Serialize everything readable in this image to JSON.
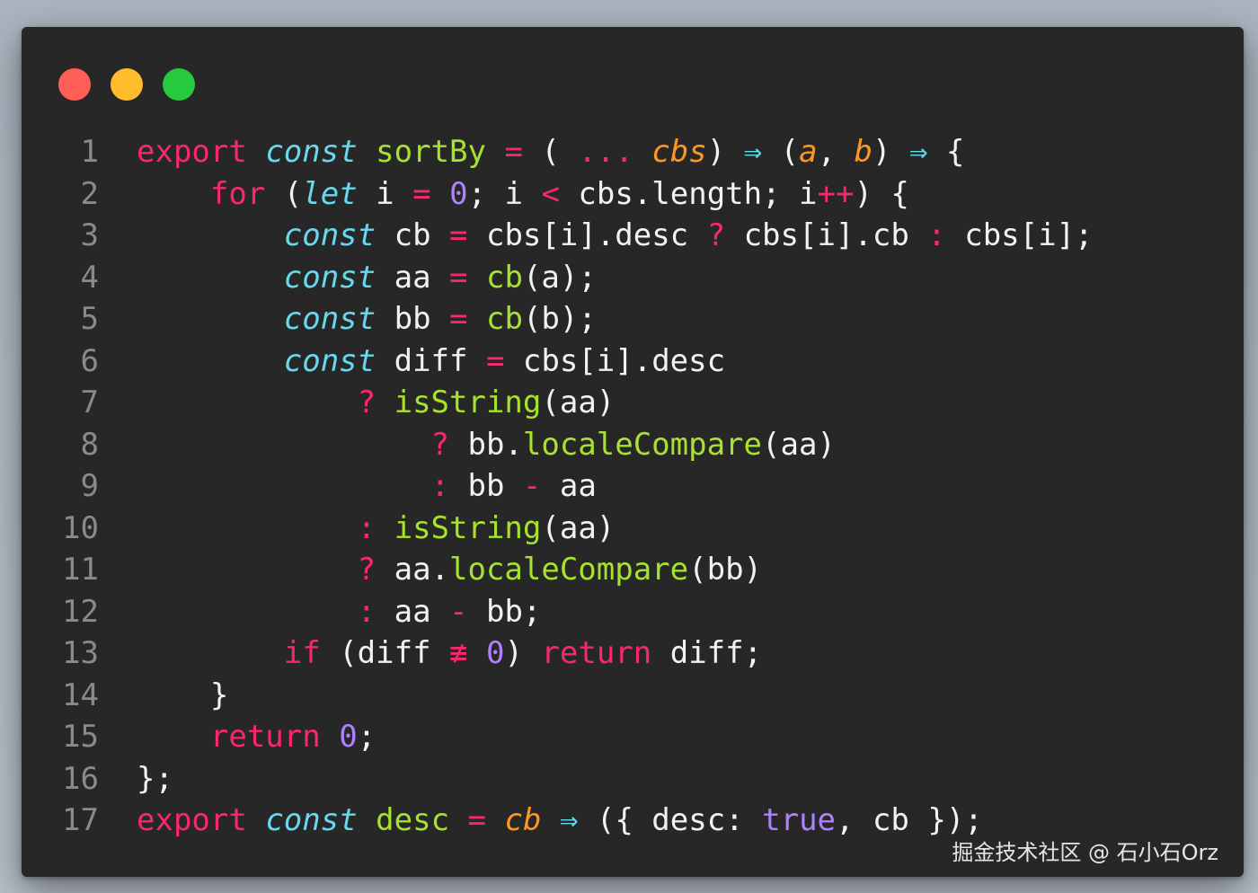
{
  "window": {
    "controls": [
      {
        "name": "close",
        "color": "#ff5f56"
      },
      {
        "name": "minimize",
        "color": "#ffbd2e"
      },
      {
        "name": "zoom",
        "color": "#27c93f"
      }
    ]
  },
  "colors": {
    "keyword": "#f92672",
    "declaration": "#66d9ef",
    "function": "#a6e22e",
    "number": "#ae81ff",
    "parameter": "#fd971f",
    "text": "#f2f2f2",
    "line_number": "#8a8a8a",
    "background": "#272727"
  },
  "code": {
    "lines": [
      {
        "num": "1",
        "tokens": [
          [
            "kw",
            "export"
          ],
          [
            "txt",
            " "
          ],
          [
            "def",
            "const"
          ],
          [
            "txt",
            " "
          ],
          [
            "fn",
            "sortBy"
          ],
          [
            "txt",
            " "
          ],
          [
            "op",
            "="
          ],
          [
            "txt",
            " ( "
          ],
          [
            "op",
            "..."
          ],
          [
            "txt",
            " "
          ],
          [
            "param",
            "cbs"
          ],
          [
            "txt",
            ") "
          ],
          [
            "arrow",
            "⇒"
          ],
          [
            "txt",
            " ("
          ],
          [
            "param",
            "a"
          ],
          [
            "txt",
            ", "
          ],
          [
            "param",
            "b"
          ],
          [
            "txt",
            ") "
          ],
          [
            "arrow",
            "⇒"
          ],
          [
            "txt",
            " {"
          ]
        ]
      },
      {
        "num": "2",
        "tokens": [
          [
            "txt",
            "    "
          ],
          [
            "kw",
            "for"
          ],
          [
            "txt",
            " ("
          ],
          [
            "def",
            "let"
          ],
          [
            "txt",
            " i "
          ],
          [
            "op",
            "="
          ],
          [
            "txt",
            " "
          ],
          [
            "num",
            "0"
          ],
          [
            "txt",
            "; i "
          ],
          [
            "op",
            "<"
          ],
          [
            "txt",
            " cbs.length; i"
          ],
          [
            "op",
            "++"
          ],
          [
            "txt",
            ") {"
          ]
        ]
      },
      {
        "num": "3",
        "tokens": [
          [
            "txt",
            "        "
          ],
          [
            "def",
            "const"
          ],
          [
            "txt",
            " cb "
          ],
          [
            "op",
            "="
          ],
          [
            "txt",
            " cbs[i].desc "
          ],
          [
            "op",
            "?"
          ],
          [
            "txt",
            " cbs[i].cb "
          ],
          [
            "op",
            ":"
          ],
          [
            "txt",
            " cbs[i];"
          ]
        ]
      },
      {
        "num": "4",
        "tokens": [
          [
            "txt",
            "        "
          ],
          [
            "def",
            "const"
          ],
          [
            "txt",
            " aa "
          ],
          [
            "op",
            "="
          ],
          [
            "txt",
            " "
          ],
          [
            "fn",
            "cb"
          ],
          [
            "txt",
            "(a);"
          ]
        ]
      },
      {
        "num": "5",
        "tokens": [
          [
            "txt",
            "        "
          ],
          [
            "def",
            "const"
          ],
          [
            "txt",
            " bb "
          ],
          [
            "op",
            "="
          ],
          [
            "txt",
            " "
          ],
          [
            "fn",
            "cb"
          ],
          [
            "txt",
            "(b);"
          ]
        ]
      },
      {
        "num": "6",
        "tokens": [
          [
            "txt",
            "        "
          ],
          [
            "def",
            "const"
          ],
          [
            "txt",
            " diff "
          ],
          [
            "op",
            "="
          ],
          [
            "txt",
            " cbs[i].desc"
          ]
        ]
      },
      {
        "num": "7",
        "tokens": [
          [
            "txt",
            "            "
          ],
          [
            "op",
            "?"
          ],
          [
            "txt",
            " "
          ],
          [
            "fn",
            "isString"
          ],
          [
            "txt",
            "(aa)"
          ]
        ]
      },
      {
        "num": "8",
        "tokens": [
          [
            "txt",
            "                "
          ],
          [
            "op",
            "?"
          ],
          [
            "txt",
            " bb."
          ],
          [
            "fn",
            "localeCompare"
          ],
          [
            "txt",
            "(aa)"
          ]
        ]
      },
      {
        "num": "9",
        "tokens": [
          [
            "txt",
            "                "
          ],
          [
            "op",
            ":"
          ],
          [
            "txt",
            " bb "
          ],
          [
            "op",
            "-"
          ],
          [
            "txt",
            " aa"
          ]
        ]
      },
      {
        "num": "10",
        "tokens": [
          [
            "txt",
            "            "
          ],
          [
            "op",
            ":"
          ],
          [
            "txt",
            " "
          ],
          [
            "fn",
            "isString"
          ],
          [
            "txt",
            "(aa)"
          ]
        ]
      },
      {
        "num": "11",
        "tokens": [
          [
            "txt",
            "            "
          ],
          [
            "op",
            "?"
          ],
          [
            "txt",
            " aa."
          ],
          [
            "fn",
            "localeCompare"
          ],
          [
            "txt",
            "(bb)"
          ]
        ]
      },
      {
        "num": "12",
        "tokens": [
          [
            "txt",
            "            "
          ],
          [
            "op",
            ":"
          ],
          [
            "txt",
            " aa "
          ],
          [
            "op",
            "-"
          ],
          [
            "txt",
            " bb;"
          ]
        ]
      },
      {
        "num": "13",
        "tokens": [
          [
            "txt",
            "        "
          ],
          [
            "kw",
            "if"
          ],
          [
            "txt",
            " (diff "
          ],
          [
            "op",
            "≢"
          ],
          [
            "txt",
            " "
          ],
          [
            "num",
            "0"
          ],
          [
            "txt",
            ") "
          ],
          [
            "kw",
            "return"
          ],
          [
            "txt",
            " diff;"
          ]
        ]
      },
      {
        "num": "14",
        "tokens": [
          [
            "txt",
            "    }"
          ]
        ]
      },
      {
        "num": "15",
        "tokens": [
          [
            "txt",
            "    "
          ],
          [
            "kw",
            "return"
          ],
          [
            "txt",
            " "
          ],
          [
            "num",
            "0"
          ],
          [
            "txt",
            ";"
          ]
        ]
      },
      {
        "num": "16",
        "tokens": [
          [
            "txt",
            "};"
          ]
        ]
      },
      {
        "num": "17",
        "tokens": [
          [
            "kw",
            "export"
          ],
          [
            "txt",
            " "
          ],
          [
            "def",
            "const"
          ],
          [
            "txt",
            " "
          ],
          [
            "fn",
            "desc"
          ],
          [
            "txt",
            " "
          ],
          [
            "op",
            "="
          ],
          [
            "txt",
            " "
          ],
          [
            "param",
            "cb"
          ],
          [
            "txt",
            " "
          ],
          [
            "arrow",
            "⇒"
          ],
          [
            "txt",
            " ({ desc: "
          ],
          [
            "num",
            "true"
          ],
          [
            "txt",
            ", cb });"
          ]
        ]
      }
    ]
  },
  "watermark": {
    "text": "掘金技术社区 @ 石小石Orz"
  }
}
